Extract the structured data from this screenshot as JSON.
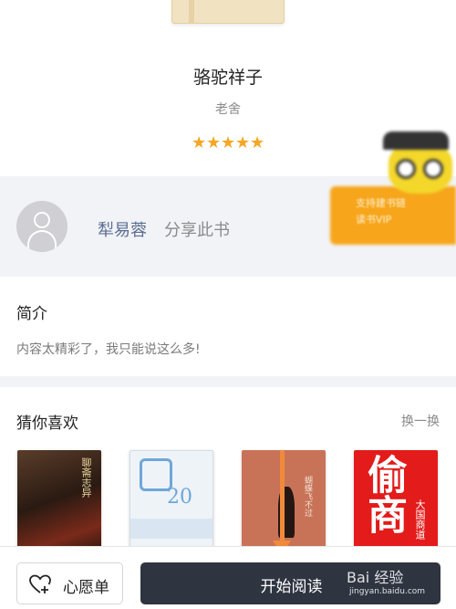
{
  "book": {
    "title": "骆驼祥子",
    "author": "老舍",
    "stars": [
      "★",
      "★",
      "★",
      "★",
      "★"
    ]
  },
  "sharer": {
    "name": "犁易蓉",
    "action": "分享此书"
  },
  "promo": {
    "line1": "支持建书链",
    "line2": "读书VIP"
  },
  "intro": {
    "title": "简介",
    "text": "内容太精彩了，我只能说这么多!"
  },
  "recommend": {
    "title": "猜你喜欢",
    "refresh": "换一换",
    "books": [
      {
        "cover_text": "聊斋志异"
      },
      {
        "cover_text": "20"
      },
      {
        "cover_text": "蝴蝶飞不过"
      },
      {
        "cover_text": "偷商",
        "sub": "大国商道"
      }
    ]
  },
  "actions": {
    "wishlist": "心愿单",
    "start_reading": "开始阅读"
  },
  "watermark": {
    "brand": "Bai 经验",
    "url": "jingyan.baidu.com"
  },
  "colors": {
    "star": "#f5a623",
    "primary_button": "#2e3440",
    "link_name": "#5b6f94",
    "promo": "#f7a51a",
    "annotation_arrow": "#f08a3a"
  },
  "icons": {
    "avatar": "user-avatar-icon",
    "wishlist": "heart-plus-icon"
  }
}
